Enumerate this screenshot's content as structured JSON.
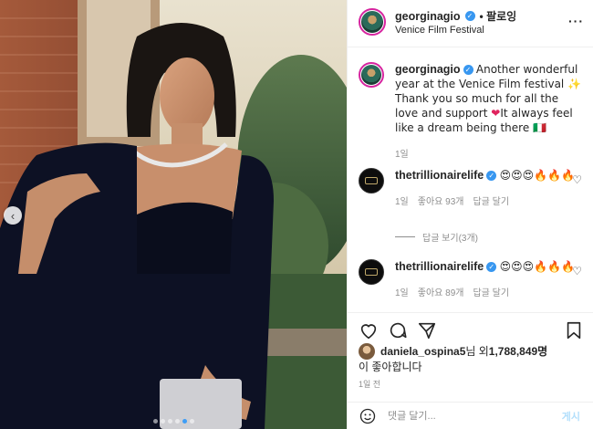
{
  "post": {
    "username": "georginagio",
    "follow_label": "• 팔로잉",
    "location": "Venice Film Festival",
    "more_label": "···"
  },
  "caption": {
    "username": "georginagio",
    "text_1": "Another wonderful year at the Venice Film festival ✨ Thank you so much for all the love and support ",
    "heart": "❤",
    "text_2": "It always feel like a dream being there 🇮🇹",
    "age": "1일"
  },
  "comments": [
    {
      "username": "thetrillionairelife",
      "text": "😍😍😍🔥🔥🔥",
      "age": "1일",
      "likes": "좋아요 93개",
      "reply": "답글 달기"
    },
    {
      "username": "thetrillionairelife",
      "text": "😍😍😍🔥🔥🔥",
      "age": "1일",
      "likes": "좋아요 89개",
      "reply": "답글 달기"
    }
  ],
  "view_replies": "답글 보기(3개)",
  "likes": {
    "liker": "daniela_ospina5",
    "rest": "님 외 ",
    "count": "1,788,849명",
    "suffix": "이 좋아합니다"
  },
  "timestamp": "1일 전",
  "add_comment": {
    "placeholder": "댓글 달기...",
    "post_label": "게시"
  },
  "carousel": {
    "dot_count": 6,
    "active_index": 4
  },
  "colors": {
    "accent": "#3897f0",
    "muted": "#8e8e8e",
    "text": "#262626"
  }
}
